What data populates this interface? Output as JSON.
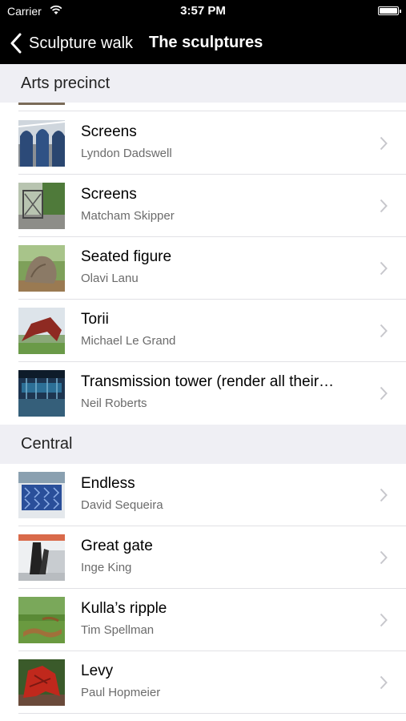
{
  "status": {
    "carrier": "Carrier",
    "time": "3:57 PM"
  },
  "nav": {
    "back_label": "Sculpture walk",
    "title": "The sculptures"
  },
  "sections": [
    {
      "title": "Arts precinct",
      "items": [
        {
          "title": "Screens",
          "subtitle": "Lyndon Dadswell",
          "thumb": "screens-photo"
        },
        {
          "title": "Screens",
          "subtitle": "Matcham Skipper",
          "thumb": "screens-photo"
        },
        {
          "title": "Seated figure",
          "subtitle": "Olavi Lanu",
          "thumb": "seated-figure-photo"
        },
        {
          "title": "Torii",
          "subtitle": "Michael Le Grand",
          "thumb": "torii-photo"
        },
        {
          "title": "Transmission tower (render all their…",
          "subtitle": "Neil Roberts",
          "thumb": "transmission-tower-photo"
        }
      ]
    },
    {
      "title": "Central",
      "items": [
        {
          "title": "Endless",
          "subtitle": "David Sequeira",
          "thumb": "endless-photo"
        },
        {
          "title": "Great gate",
          "subtitle": "Inge King",
          "thumb": "great-gate-photo"
        },
        {
          "title": "Kulla’s ripple",
          "subtitle": "Tim Spellman",
          "thumb": "kullas-ripple-photo"
        },
        {
          "title": "Levy",
          "subtitle": "Paul Hopmeier",
          "thumb": "levy-photo"
        }
      ]
    }
  ]
}
